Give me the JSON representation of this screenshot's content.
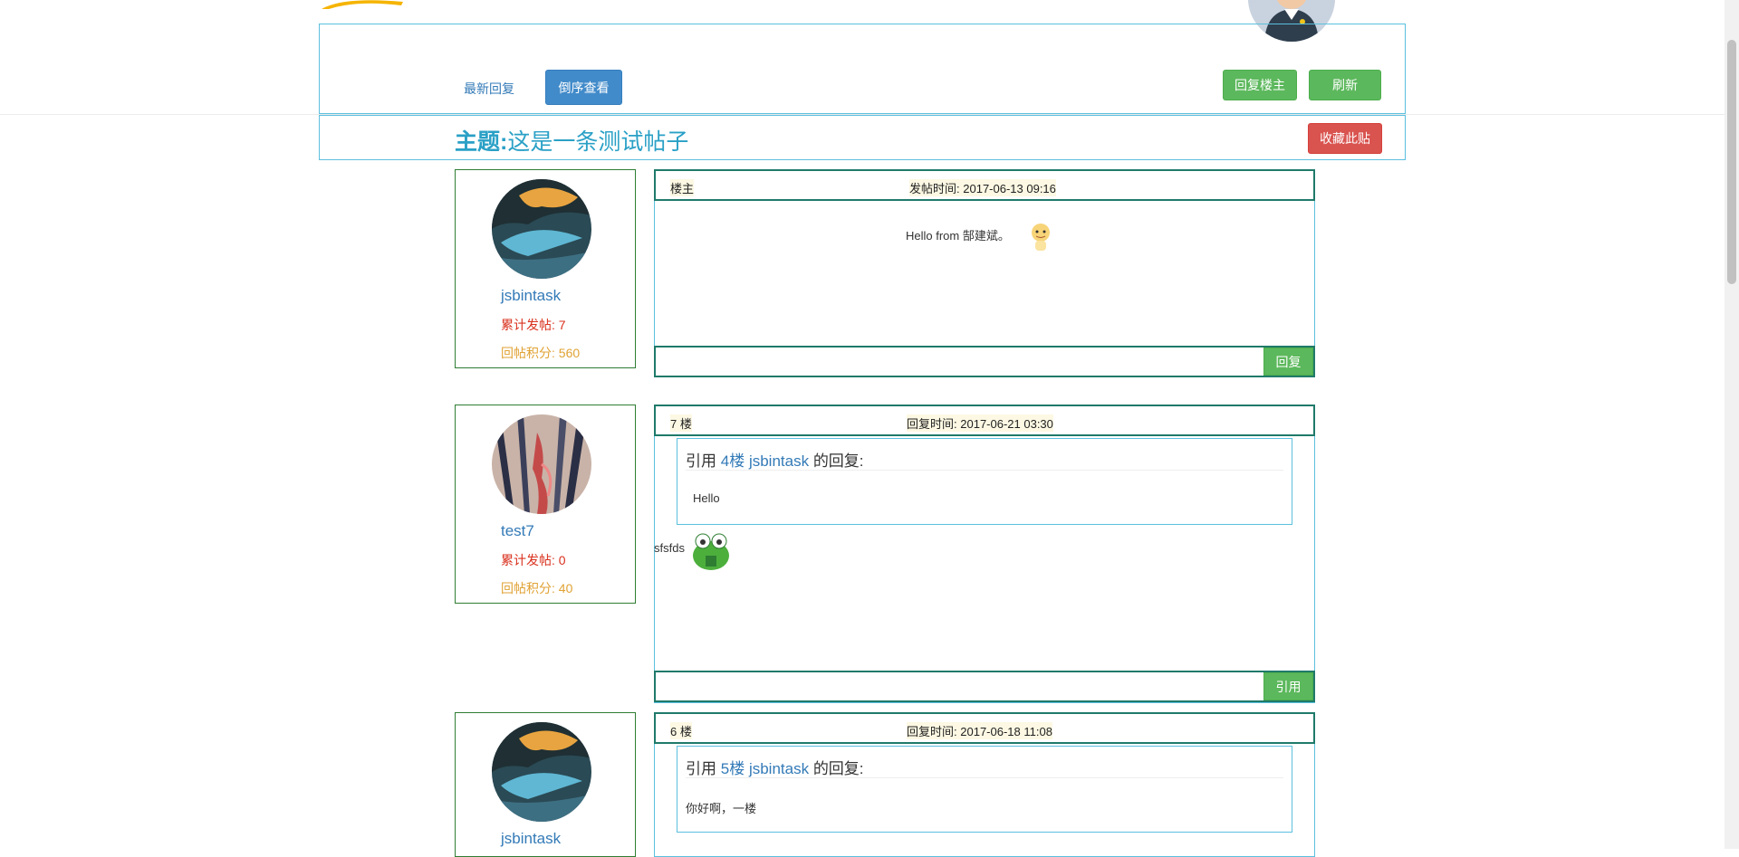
{
  "toolbar": {
    "latest_reply_link": "最新回复",
    "reverse_order_button": "倒序查看",
    "reply_op_button": "回复楼主",
    "refresh_button": "刷新"
  },
  "topic": {
    "label": "主题:",
    "title": "这是一条测试帖子",
    "favorite_button": "收藏此贴"
  },
  "posts": [
    {
      "user": {
        "name": "jsbintask",
        "posts_label": "累计发帖:",
        "posts_count": "7",
        "score_label": "回帖积分:",
        "score": "560"
      },
      "floor": "楼主",
      "time_label": "发帖时间:",
      "time": "2017-06-13 09:16",
      "content": "Hello from 郜建斌。",
      "emoji": "tiger-emoji",
      "action_button": "回复"
    },
    {
      "user": {
        "name": "test7",
        "posts_label": "累计发帖:",
        "posts_count": "0",
        "score_label": "回帖积分:",
        "score": "40"
      },
      "floor": "7 楼",
      "time_label": "回复时间:",
      "time": "2017-06-21 03:30",
      "quote": {
        "prefix": "引用",
        "floor": "4楼",
        "user": "jsbintask",
        "suffix": "的回复:",
        "text": "Hello"
      },
      "content": "sfsfds",
      "emoji": "frog-emoji",
      "action_button": "引用"
    },
    {
      "user": {
        "name": "jsbintask"
      },
      "floor": "6 楼",
      "time_label": "回复时间:",
      "time": "2017-06-18 11:08",
      "quote": {
        "prefix": "引用",
        "floor": "5楼",
        "user": "jsbintask",
        "suffix": "的回复:",
        "text": "你好啊，一楼"
      }
    }
  ],
  "colors": {
    "accent": "#2aa0c6",
    "border_teal": "#5bc0de",
    "card_border": "#2e7d32",
    "success": "#5cb85c",
    "primary": "#428bca",
    "danger": "#d9534f",
    "posts_red": "#d9301d",
    "score_orange": "#e0a234"
  }
}
